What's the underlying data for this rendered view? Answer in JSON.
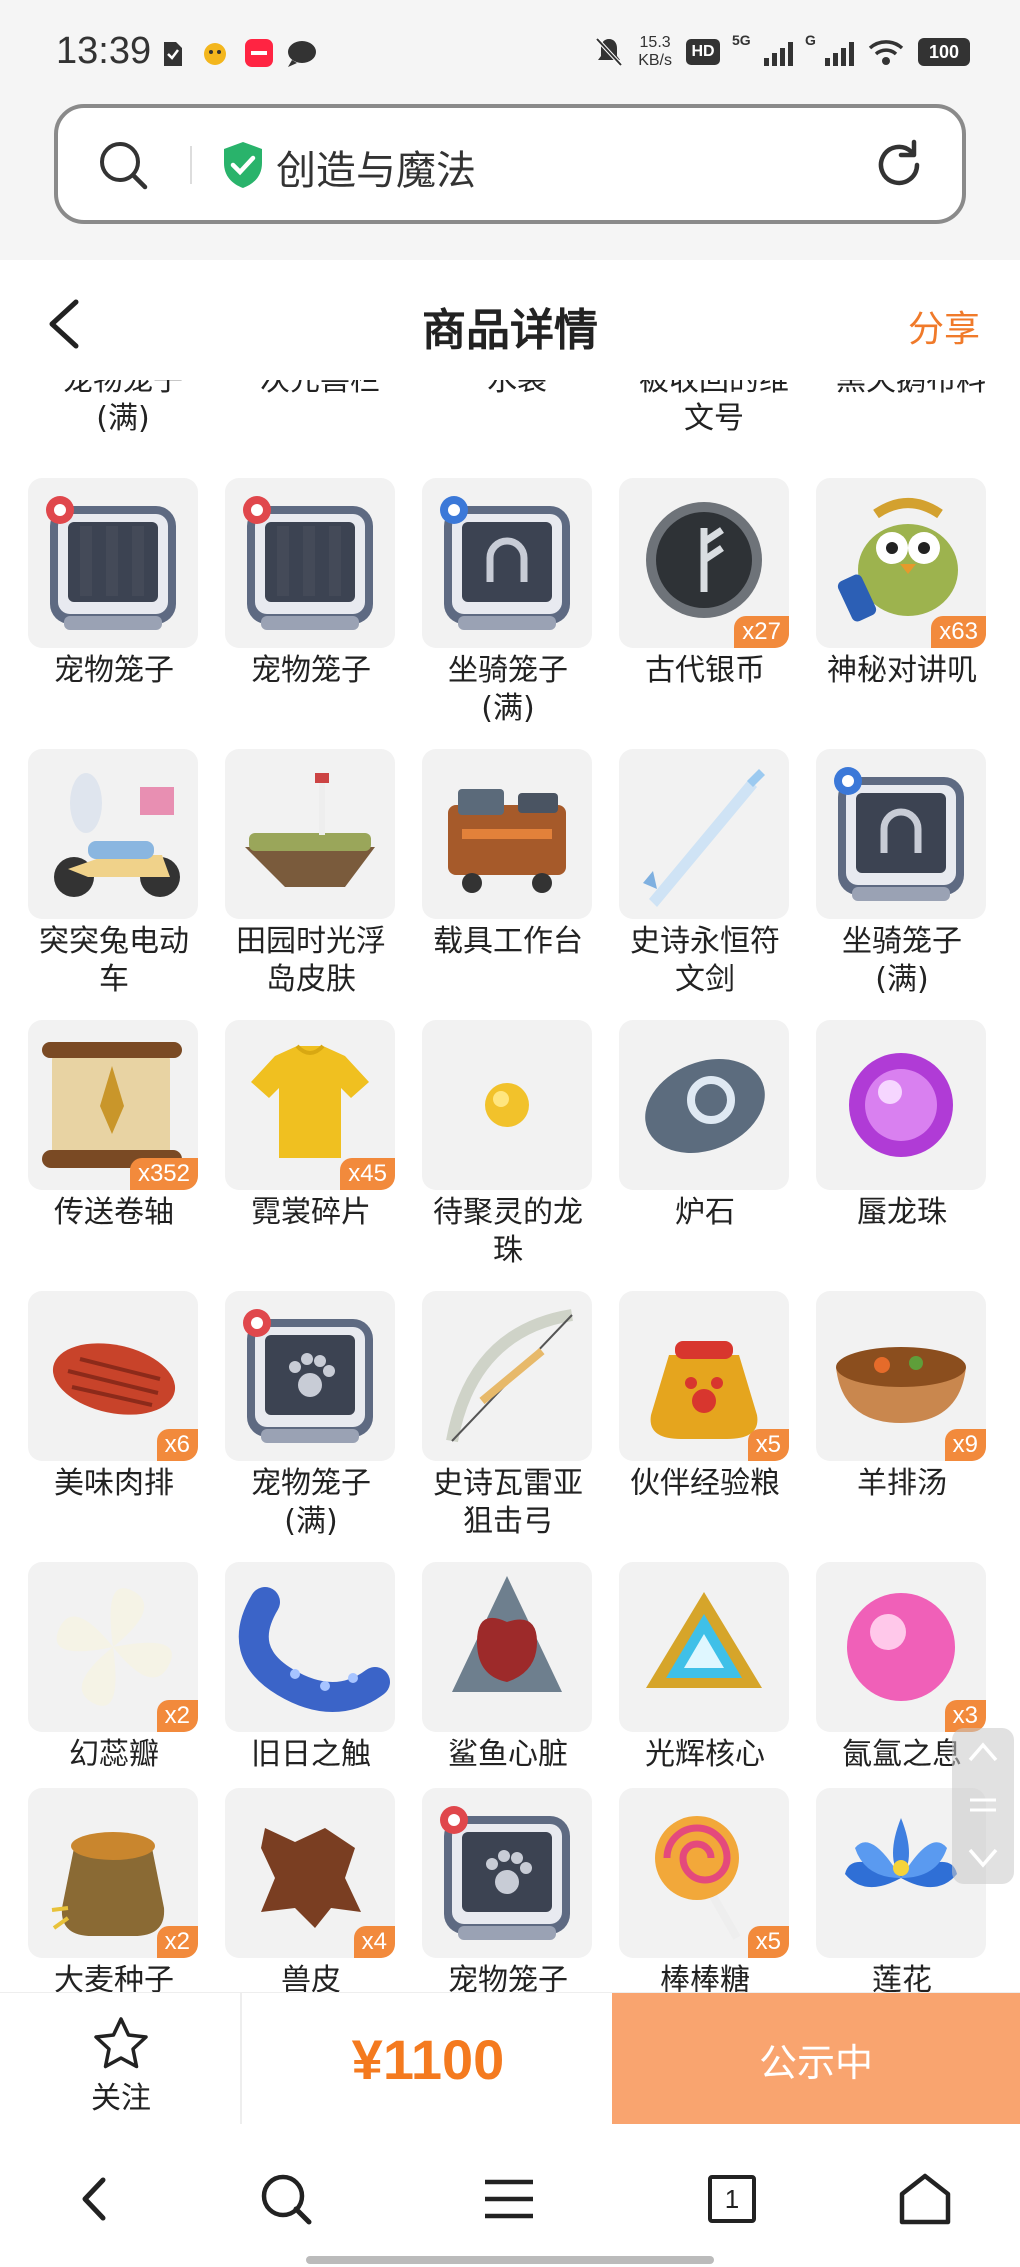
{
  "status_bar": {
    "time": "13:39",
    "net_speed_value": "15.3",
    "net_speed_unit": "KB/s",
    "hd_label": "HD",
    "sim1_label": "5G",
    "sim2_label": "G",
    "battery": "100"
  },
  "address_bar": {
    "text": "创造与魔法"
  },
  "header": {
    "title": "商品详情",
    "share_label": "分享"
  },
  "top_row_names": [
    "宠物笼子\n(满)",
    "次元兽栏",
    "水袋",
    "被收回的维\n文号",
    "黑天鹅布料"
  ],
  "items": [
    {
      "name": "宠物笼子",
      "qty": "",
      "icon": "pet-cage-icon"
    },
    {
      "name": "宠物笼子",
      "qty": "",
      "icon": "pet-cage-icon"
    },
    {
      "name": "坐骑笼子\n(满)",
      "qty": "",
      "icon": "mount-cage-icon"
    },
    {
      "name": "古代银币",
      "qty": "x27",
      "icon": "silver-coin-icon"
    },
    {
      "name": "神秘对讲叽",
      "qty": "x63",
      "icon": "walkie-bird-icon"
    },
    {
      "name": "突突兔电动\n车",
      "qty": "",
      "icon": "scooter-icon"
    },
    {
      "name": "田园时光浮\n岛皮肤",
      "qty": "",
      "icon": "floating-island-icon"
    },
    {
      "name": "载具工作台",
      "qty": "",
      "icon": "workbench-icon"
    },
    {
      "name": "史诗永恒符\n文剑",
      "qty": "",
      "icon": "rune-sword-icon"
    },
    {
      "name": "坐骑笼子\n(满)",
      "qty": "",
      "icon": "mount-cage-icon"
    },
    {
      "name": "传送卷轴",
      "qty": "x352",
      "icon": "teleport-scroll-icon"
    },
    {
      "name": "霓裳碎片",
      "qty": "x45",
      "icon": "shirt-fragment-icon"
    },
    {
      "name": "待聚灵的龙\n珠",
      "qty": "",
      "icon": "dragon-pearl-icon"
    },
    {
      "name": "炉石",
      "qty": "",
      "icon": "hearthstone-icon"
    },
    {
      "name": "蜃龙珠",
      "qty": "",
      "icon": "purple-orb-icon"
    },
    {
      "name": "美味肉排",
      "qty": "x6",
      "icon": "steak-icon"
    },
    {
      "name": "宠物笼子\n(满)",
      "qty": "",
      "icon": "pet-cage-full-icon"
    },
    {
      "name": "史诗瓦雷亚\n狙击弓",
      "qty": "",
      "icon": "sniper-bow-icon"
    },
    {
      "name": "伙伴经验粮",
      "qty": "x5",
      "icon": "exp-bag-icon"
    },
    {
      "name": "羊排汤",
      "qty": "x9",
      "icon": "soup-icon"
    },
    {
      "name": "幻蕊瓣",
      "qty": "x2",
      "icon": "petal-icon"
    },
    {
      "name": "旧日之触",
      "qty": "",
      "icon": "tentacle-icon"
    },
    {
      "name": "鲨鱼心脏",
      "qty": "",
      "icon": "shark-heart-icon"
    },
    {
      "name": "光辉核心",
      "qty": "",
      "icon": "radiant-core-icon"
    },
    {
      "name": "氤氲之息",
      "qty": "x3",
      "icon": "pink-orb-icon"
    },
    {
      "name": "大麦种子",
      "qty": "x2",
      "icon": "seed-sack-icon"
    },
    {
      "name": "兽皮",
      "qty": "x4",
      "icon": "hide-icon"
    },
    {
      "name": "宠物笼子",
      "qty": "",
      "icon": "pet-cage-full-icon"
    },
    {
      "name": "棒棒糖",
      "qty": "x5",
      "icon": "lollipop-icon"
    },
    {
      "name": "莲花",
      "qty": "",
      "icon": "lotus-icon"
    }
  ],
  "action_bar": {
    "follow_label": "关注",
    "price": "¥1100",
    "status_label": "公示中"
  },
  "nav_bar": {
    "tabs_count": "1"
  },
  "colors": {
    "accent": "#f47a1f",
    "button": "#f9a46f",
    "badge": "#f28a3c"
  }
}
